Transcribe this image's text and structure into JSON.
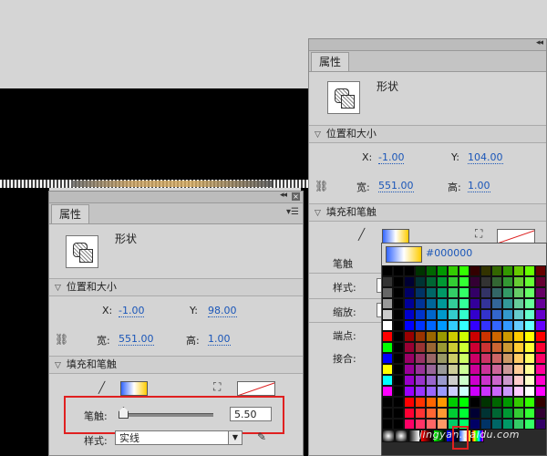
{
  "panels": {
    "front": {
      "tab": "属性",
      "shape_type": "形状",
      "section_position": "位置和大小",
      "x_label": "X:",
      "x_value": "-1.00",
      "y_label": "Y:",
      "y_value": "98.00",
      "width_label": "宽:",
      "width_value": "551.00",
      "height_label": "高:",
      "height_value": "1.00",
      "section_fill": "填充和笔触",
      "stroke_label": "笔触:",
      "stroke_value": "5.50",
      "style_label": "样式:",
      "style_value": "实线"
    },
    "back": {
      "tab": "属性",
      "shape_type": "形状",
      "section_position": "位置和大小",
      "x_label": "X:",
      "x_value": "-1.00",
      "y_label": "Y:",
      "y_value": "104.00",
      "width_label": "宽:",
      "width_value": "551.00",
      "height_label": "高:",
      "height_value": "1.00",
      "section_fill": "填充和笔触",
      "stroke_label": "笔触",
      "style_label": "样式:",
      "scale_label": "缩放:",
      "cap_label": "端点:",
      "join_label": "接合:"
    }
  },
  "palette": {
    "hex": "#000000"
  },
  "watermark": "jingyan.baidu.com",
  "colors": {
    "link_blue": "#1a56b8",
    "highlight_red": "#e02020",
    "panel_bg": "#d4d4d4"
  }
}
